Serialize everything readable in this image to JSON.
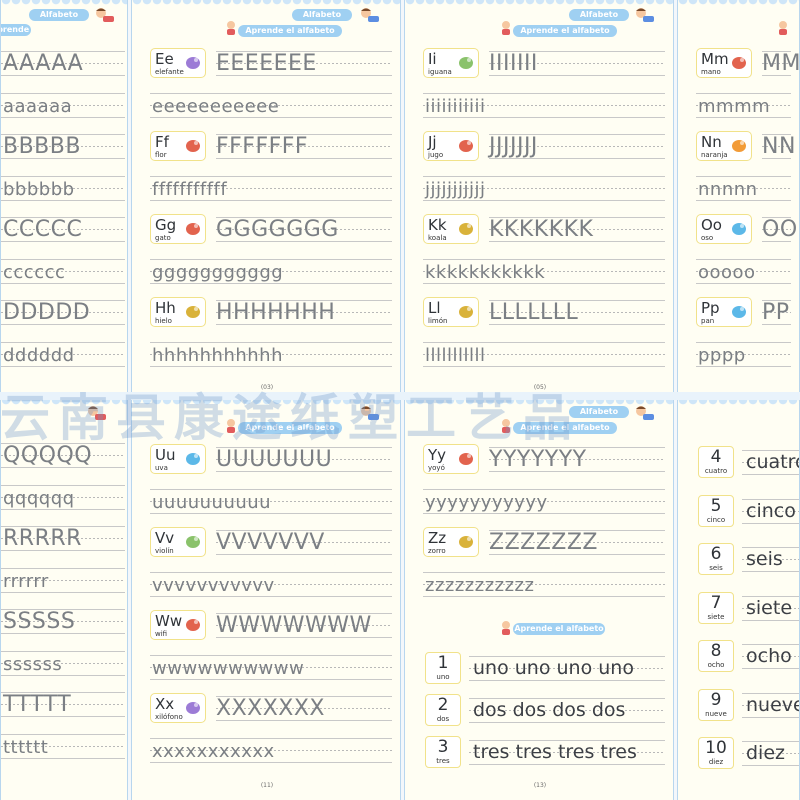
{
  "header": {
    "pill_small": "Alfabeto",
    "pill_large": "Aprende el alfabeto"
  },
  "page_numbers": [
    "(03)",
    "(05)",
    "(11)",
    "(13)"
  ],
  "watermark": "云南县康途纸塑工艺品",
  "top_row": {
    "p1": [
      "AAAAA",
      "aaaaaa",
      "BBBBB",
      "bbbbbb",
      "CCCCC",
      "cccccc",
      "DDDDD",
      "dddddd"
    ],
    "p2": [
      {
        "badge": "Ee",
        "word": "elefante",
        "upper": "EEEEEEE",
        "lower": "eeeeeeeeeee"
      },
      {
        "badge": "Ff",
        "word": "flor",
        "upper": "FFFFFFF",
        "lower": "fffffffffff"
      },
      {
        "badge": "Gg",
        "word": "gato",
        "upper": "GGGGGGG",
        "lower": "ggggggggggg"
      },
      {
        "badge": "Hh",
        "word": "hielo",
        "upper": "HHHHHHH",
        "lower": "hhhhhhhhhhh"
      }
    ],
    "p3": [
      {
        "badge": "Ii",
        "word": "iguana",
        "upper": "IIIIIII",
        "lower": "iiiiiiiiiii"
      },
      {
        "badge": "Jj",
        "word": "jugo",
        "upper": "JJJJJJJ",
        "lower": "jjjjjjjjjjj"
      },
      {
        "badge": "Kk",
        "word": "koala",
        "upper": "KKKKKKK",
        "lower": "kkkkkkkkkkk"
      },
      {
        "badge": "Ll",
        "word": "limón",
        "upper": "LLLLLLL",
        "lower": "lllllllllll"
      }
    ],
    "p4": [
      {
        "badge": "Mm",
        "word": "mano",
        "upper": "MM",
        "lower": "mmmm"
      },
      {
        "badge": "Nn",
        "word": "naranja",
        "upper": "NN",
        "lower": "nnnnn"
      },
      {
        "badge": "Oo",
        "word": "oso",
        "upper": "OO",
        "lower": "ooooo"
      },
      {
        "badge": "Pp",
        "word": "pan",
        "upper": "PP",
        "lower": "pppp"
      }
    ]
  },
  "bottom_row": {
    "p5": [
      "QQQQQ",
      "qqqqqq",
      "RRRRR",
      "rrrrrr",
      "SSSSS",
      "ssssss",
      "TTTTT",
      "tttttt"
    ],
    "p6": [
      {
        "badge": "Uu",
        "word": "uva",
        "upper": "UUUUUUU",
        "lower": "uuuuuuuuuu"
      },
      {
        "badge": "Vv",
        "word": "violín",
        "upper": "VVVVVVV",
        "lower": "vvvvvvvvvvv"
      },
      {
        "badge": "Ww",
        "word": "wifi",
        "upper": "WWWWWWW",
        "lower": "wwwwwwwwww"
      },
      {
        "badge": "Xx",
        "word": "xilófono",
        "upper": "XXXXXXX",
        "lower": "xxxxxxxxxxx"
      }
    ],
    "p7": {
      "letters": [
        {
          "badge": "Yy",
          "word": "yoyó",
          "upper": "YYYYYYY",
          "lower": "yyyyyyyyyyy"
        },
        {
          "badge": "Zz",
          "word": "zorro",
          "upper": "ZZZZZZZ",
          "lower": "zzzzzzzzzzz"
        }
      ],
      "numbers": [
        {
          "n": "1",
          "word": "uno",
          "trace": "uno  uno  uno  uno"
        },
        {
          "n": "2",
          "word": "dos",
          "trace": "dos  dos  dos  dos"
        },
        {
          "n": "3",
          "word": "tres",
          "trace": "tres  tres  tres  tres"
        }
      ]
    },
    "p8": [
      {
        "n": "4",
        "word": "cuatro",
        "trace": "cuatro"
      },
      {
        "n": "5",
        "word": "cinco",
        "trace": "cinco"
      },
      {
        "n": "6",
        "word": "seis",
        "trace": "seis"
      },
      {
        "n": "7",
        "word": "siete",
        "trace": "siete"
      },
      {
        "n": "8",
        "word": "ocho",
        "trace": "ocho"
      },
      {
        "n": "9",
        "word": "nueve",
        "trace": "nueve"
      },
      {
        "n": "10",
        "word": "diez",
        "trace": "diez"
      }
    ]
  }
}
